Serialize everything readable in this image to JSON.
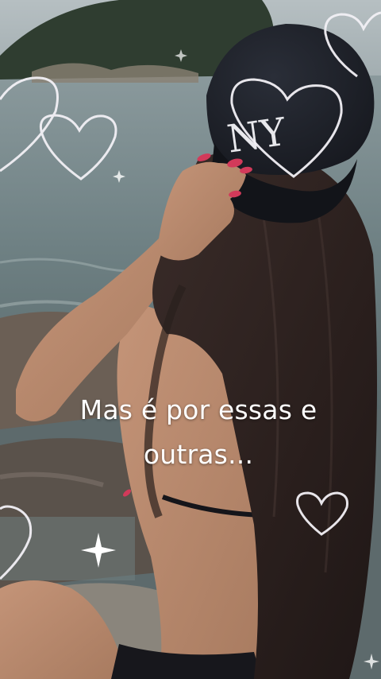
{
  "caption": {
    "line1": "Mas é por essas e",
    "line2": "outras..."
  },
  "colors": {
    "sky": "#a9b4b7",
    "sea": "#7c8d90",
    "hill": "#2f3d30",
    "cap": "#1a1d24",
    "hair": "#2a1f1e",
    "skin": "#b8876b",
    "nails": "#d23a5a",
    "heart_outline": "#f1eff4"
  },
  "overlay": {
    "heart_icons": 6,
    "sparkle_icons": 4
  }
}
